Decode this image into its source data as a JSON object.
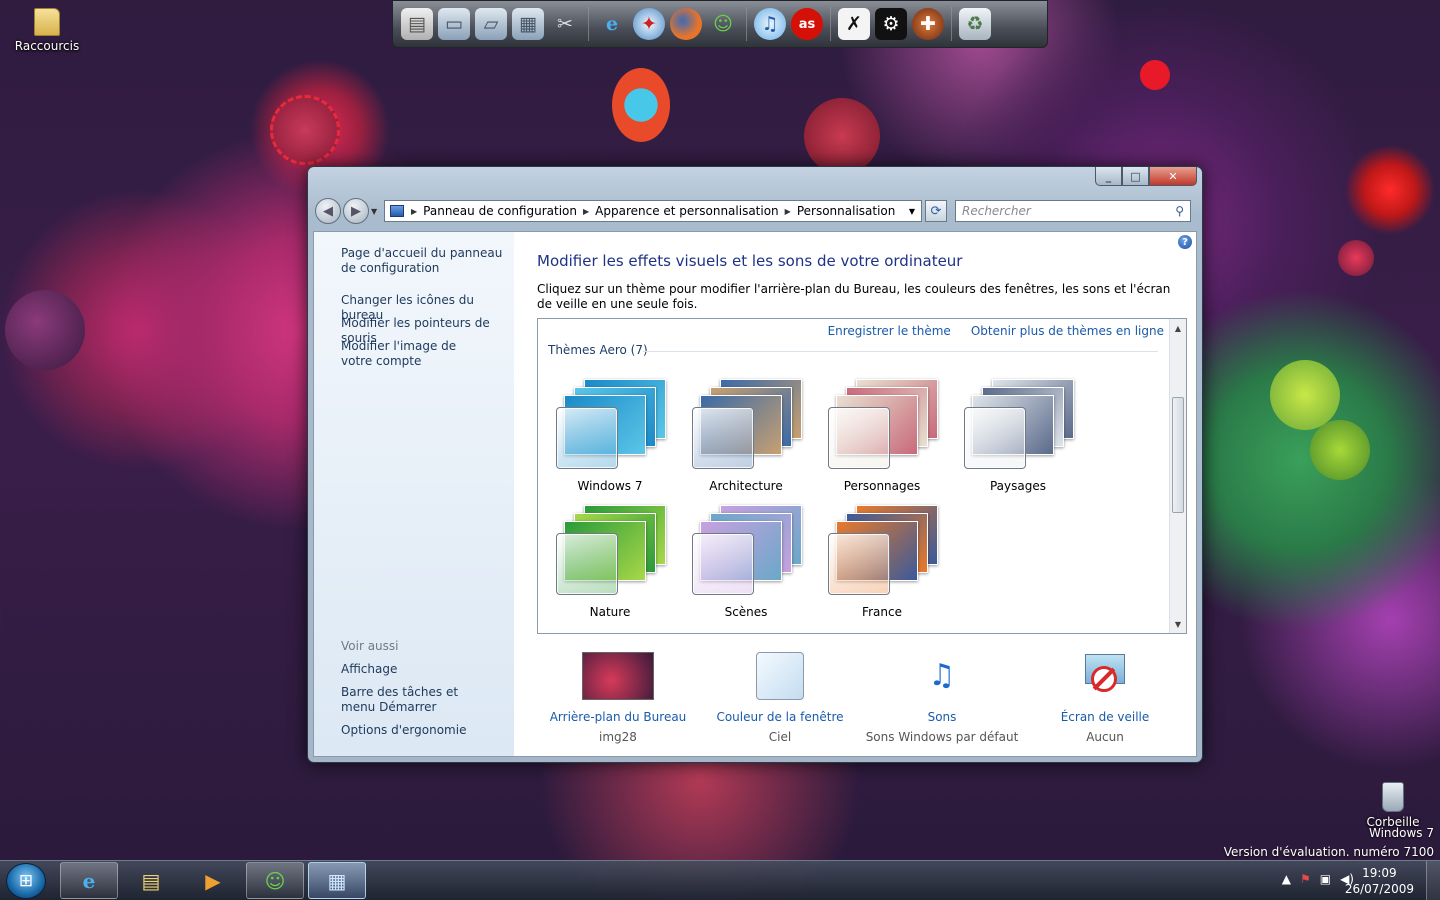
{
  "desktop": {
    "icons": [
      {
        "label": "Raccourcis",
        "icon": "folder-icon"
      },
      {
        "label": "Corbeille",
        "icon": "recycle-bin-icon"
      }
    ],
    "watermark_line1": "Windows 7",
    "watermark_line2": "Version d'évaluation. numéro 7100"
  },
  "dock": {
    "items": [
      "file-icon",
      "folder-icon",
      "folder-open-icon",
      "documents-icon",
      "tools-icon",
      "internet-explorer-icon",
      "safari-icon",
      "firefox-icon",
      "messenger-icon",
      "itunes-icon",
      "lastfm-icon",
      "xfire-icon",
      "steam-icon",
      "tf2-icon",
      "recycle-bin-icon"
    ]
  },
  "window": {
    "address": {
      "crumbs": [
        "Panneau de configuration",
        "Apparence et personnalisation",
        "Personnalisation"
      ]
    },
    "search_placeholder": "Rechercher",
    "left_links": [
      "Page d'accueil du panneau de configuration",
      "Changer les icônes du bureau",
      "Modifier les pointeurs de souris",
      "Modifier l'image de votre compte"
    ],
    "see_also_title": "Voir aussi",
    "see_also": [
      "Affichage",
      "Barre des tâches et menu Démarrer",
      "Options d'ergonomie"
    ],
    "title": "Modifier les effets visuels et les sons de votre ordinateur",
    "description": "Cliquez sur un thème pour modifier l'arrière-plan du Bureau, les couleurs des fenêtres, les sons et l'écran de veille en une seule fois.",
    "save_theme": "Enregistrer le thème",
    "get_more_themes": "Obtenir plus de thèmes en ligne",
    "group_title": "Thèmes Aero (7)",
    "themes": [
      {
        "name": "Windows 7",
        "colors": [
          "#1a8ac8",
          "#5cc6e8"
        ]
      },
      {
        "name": "Architecture",
        "colors": [
          "#3a6aa8",
          "#c8a070"
        ]
      },
      {
        "name": "Personnages",
        "colors": [
          "#e8e0d0",
          "#c86a7a"
        ]
      },
      {
        "name": "Paysages",
        "colors": [
          "#dfe4ea",
          "#5a6a8a"
        ]
      },
      {
        "name": "Nature",
        "colors": [
          "#2a9a3a",
          "#a8d848"
        ]
      },
      {
        "name": "Scènes",
        "colors": [
          "#c8a0e0",
          "#6aa8c8"
        ]
      },
      {
        "name": "France",
        "colors": [
          "#e87a2a",
          "#3a5a9a"
        ]
      }
    ],
    "bottom": [
      {
        "label": "Arrière-plan du Bureau",
        "value": "img28"
      },
      {
        "label": "Couleur de la fenêtre",
        "value": "Ciel"
      },
      {
        "label": "Sons",
        "value": "Sons Windows par défaut"
      },
      {
        "label": "Écran de veille",
        "value": "Aucun"
      }
    ]
  },
  "taskbar": {
    "time": "19:09",
    "date": "26/07/2009"
  }
}
